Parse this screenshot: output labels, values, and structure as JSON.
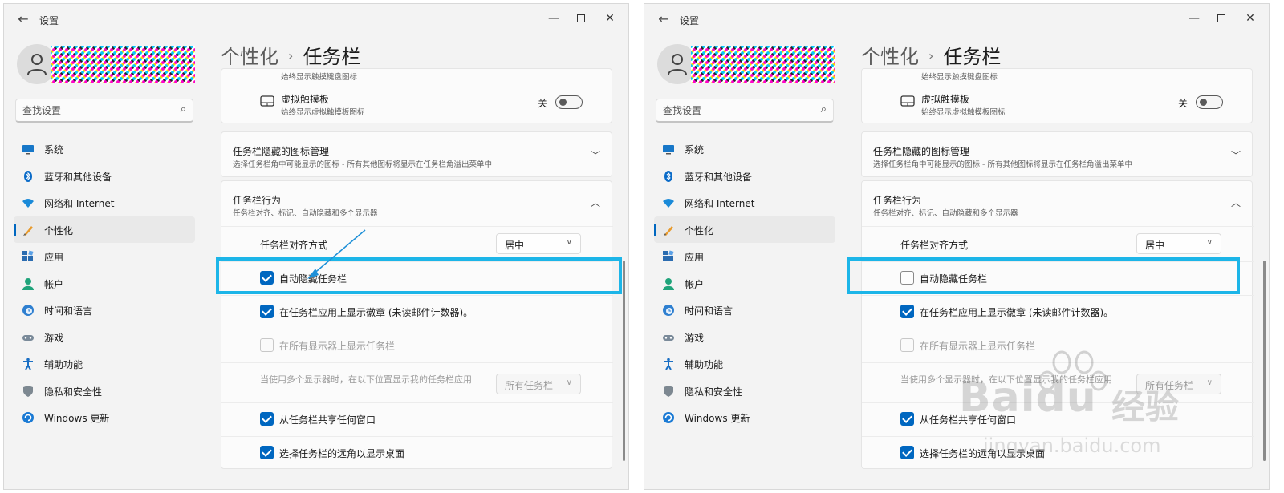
{
  "app_title": "设置",
  "search_placeholder": "查找设置",
  "breadcrumb": {
    "parent": "个性化",
    "separator": "›",
    "current": "任务栏"
  },
  "nav": [
    {
      "label": "系统",
      "icon": "monitor-icon"
    },
    {
      "label": "蓝牙和其他设备",
      "icon": "bluetooth-icon"
    },
    {
      "label": "网络和 Internet",
      "icon": "wifi-icon"
    },
    {
      "label": "个性化",
      "icon": "brush-icon"
    },
    {
      "label": "应用",
      "icon": "apps-icon"
    },
    {
      "label": "帐户",
      "icon": "account-icon"
    },
    {
      "label": "时间和语言",
      "icon": "globe-clock-icon"
    },
    {
      "label": "游戏",
      "icon": "gamepad-icon"
    },
    {
      "label": "辅助功能",
      "icon": "accessibility-icon"
    },
    {
      "label": "隐私和安全性",
      "icon": "shield-icon"
    },
    {
      "label": "Windows 更新",
      "icon": "update-icon"
    }
  ],
  "cut_off_desc": "始终显示触摸键盘图标",
  "touchpad": {
    "title": "虚拟触摸板",
    "desc": "始终显示虚拟触摸板图标",
    "state_label": "关",
    "state": false
  },
  "overflow_section": {
    "title": "任务栏隐藏的图标管理",
    "desc": "选择任务栏角中可能显示的图标 - 所有其他图标将显示在任务栏角溢出菜单中"
  },
  "behavior_section": {
    "title": "任务栏行为",
    "desc": "任务栏对齐、标记、自动隐藏和多个显示器"
  },
  "alignment": {
    "label": "任务栏对齐方式",
    "value": "居中"
  },
  "options": {
    "autohide": "自动隐藏任务栏",
    "badges": "在任务栏应用上显示徽章 (未读邮件计数器)。",
    "all_displays": "在所有显示器上显示任务栏",
    "multi_display_label": "当使用多个显示器时，在以下位置显示我的任务栏应用",
    "multi_display_value": "所有任务栏",
    "share_window": "从任务栏共享任何窗口",
    "show_desktop": "选择任务栏的远角以显示桌面"
  },
  "windows": [
    {
      "label": "before",
      "autohide_checked": true,
      "badges_checked": true,
      "all_displays_checked": false,
      "share_window_checked": true,
      "show_desktop_checked": true
    },
    {
      "label": "after",
      "autohide_checked": false,
      "badges_checked": true,
      "all_displays_checked": false,
      "share_window_checked": true,
      "show_desktop_checked": true
    }
  ],
  "watermark": {
    "brand": "Baidu",
    "cn": "经验",
    "url": "jingyan.baidu.com"
  },
  "colors": {
    "accent": "#0067c0",
    "highlight": "#1cb5e8",
    "arrow": "#1e90d8"
  }
}
